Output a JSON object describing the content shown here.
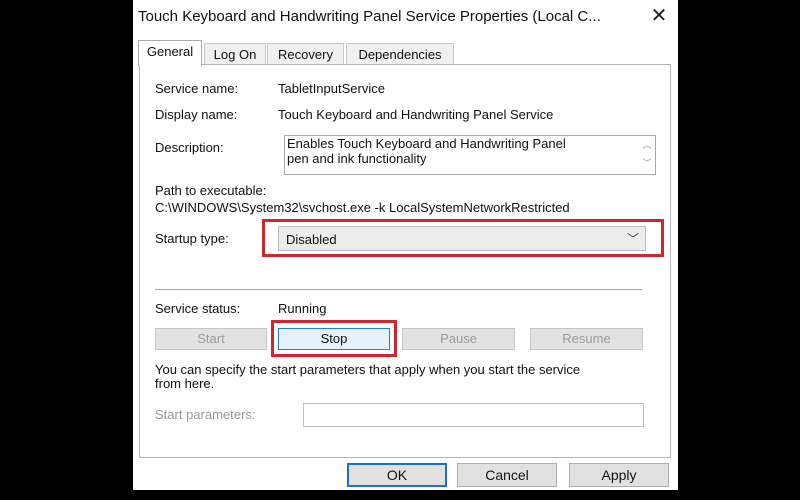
{
  "window": {
    "title": "Touch Keyboard and Handwriting Panel Service Properties (Local C...",
    "close_glyph": "✕"
  },
  "tabs": [
    "General",
    "Log On",
    "Recovery",
    "Dependencies"
  ],
  "active_tab": "General",
  "general": {
    "service_name_label": "Service name:",
    "service_name": "TabletInputService",
    "display_name_label": "Display name:",
    "display_name": "Touch Keyboard and Handwriting Panel Service",
    "description_label": "Description:",
    "description_line1": "Enables Touch Keyboard and Handwriting Panel",
    "description_line2": "pen and ink functionality",
    "path_label": "Path to executable:",
    "path": "C:\\WINDOWS\\System32\\svchost.exe -k LocalSystemNetworkRestricted",
    "startup_type_label": "Startup type:",
    "startup_type": "Disabled",
    "service_status_label": "Service status:",
    "service_status": "Running",
    "buttons": {
      "start": "Start",
      "stop": "Stop",
      "pause": "Pause",
      "resume": "Resume"
    },
    "hint_line1": "You can specify the start parameters that apply when you start the service",
    "hint_line2": "from here.",
    "start_params_label": "Start parameters:",
    "start_params_value": ""
  },
  "footer": {
    "ok": "OK",
    "cancel": "Cancel",
    "apply": "Apply"
  },
  "colors": {
    "highlight": "#d0262d",
    "focus": "#2a7ad6"
  }
}
